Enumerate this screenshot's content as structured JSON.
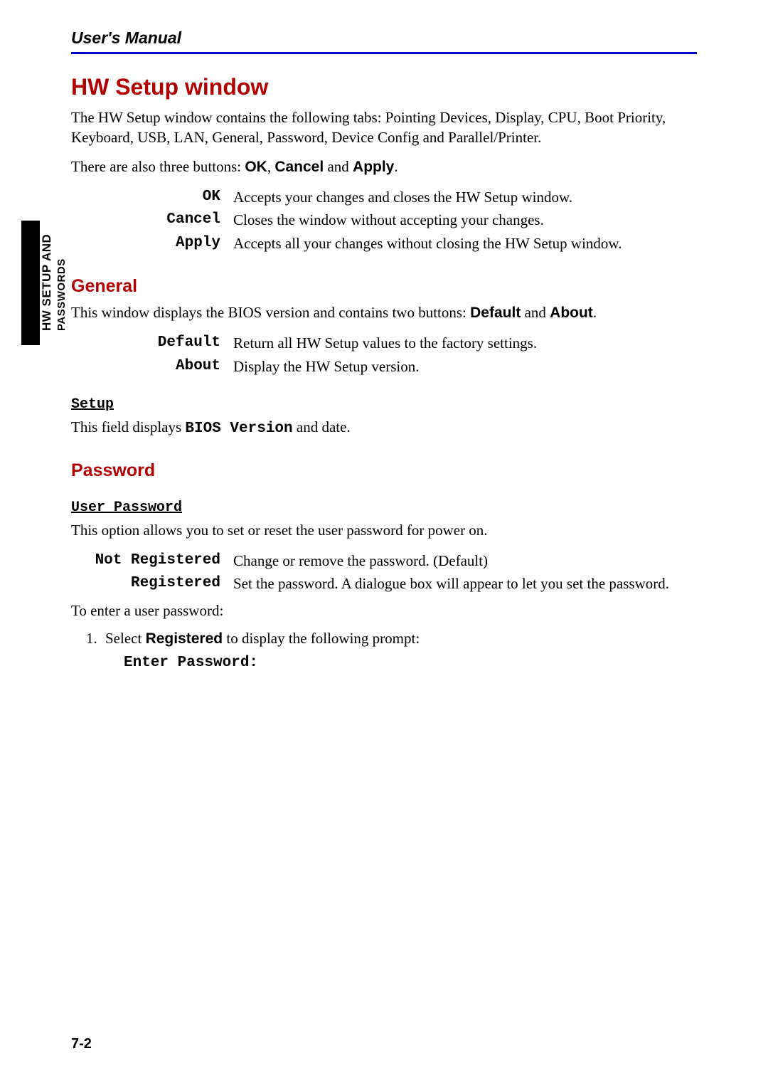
{
  "header": {
    "title": "User's Manual"
  },
  "side_tab": {
    "line1": "HW SETUP AND",
    "line2": "PASSWORDS"
  },
  "section": {
    "title": "HW Setup window",
    "intro": "The HW Setup window contains the following tabs: Pointing Devices, Display, CPU, Boot Priority, Keyboard, USB, LAN, General, Password, Device Config and Parallel/Printer.",
    "buttons_sentence_pre": "There are also three buttons: ",
    "buttons_ok": "OK",
    "buttons_sep1": ", ",
    "buttons_cancel": "Cancel",
    "buttons_sep2": " and ",
    "buttons_apply": "Apply",
    "buttons_period": "."
  },
  "buttons_table": [
    {
      "term": "OK",
      "desc": "Accepts your changes and closes the HW Setup window."
    },
    {
      "term": "Cancel",
      "desc": "Closes the window without accepting your changes."
    },
    {
      "term": "Apply",
      "desc": "Accepts all your changes without closing the HW Setup window."
    }
  ],
  "general": {
    "title": "General",
    "intro_pre": "This window displays the BIOS version and contains two buttons: ",
    "default_word": "Default",
    "and_word": " and ",
    "about_word": "About",
    "period": ".",
    "table": [
      {
        "term": "Default",
        "desc": "Return all HW Setup values to the factory settings."
      },
      {
        "term": "About",
        "desc": "Display the HW Setup version."
      }
    ],
    "setup_heading": "Setup",
    "setup_text_pre": "This field displays ",
    "setup_bold": "BIOS Version",
    "setup_text_post": " and date."
  },
  "password": {
    "title": "Password",
    "user_heading": "User Password",
    "intro": "This option allows you to set or reset the user password for power on.",
    "table": [
      {
        "term": "Not Registered",
        "desc": "Change or remove the password. (Default)"
      },
      {
        "term": "Registered",
        "desc": "Set the password. A dialogue box will appear to let you set the password."
      }
    ],
    "enter_intro": "To enter a user password:",
    "step1_pre": "Select ",
    "step1_bold": "Registered",
    "step1_post": " to display the following prompt:",
    "enter_password_prompt": "Enter Password:"
  },
  "page_number": "7-2"
}
